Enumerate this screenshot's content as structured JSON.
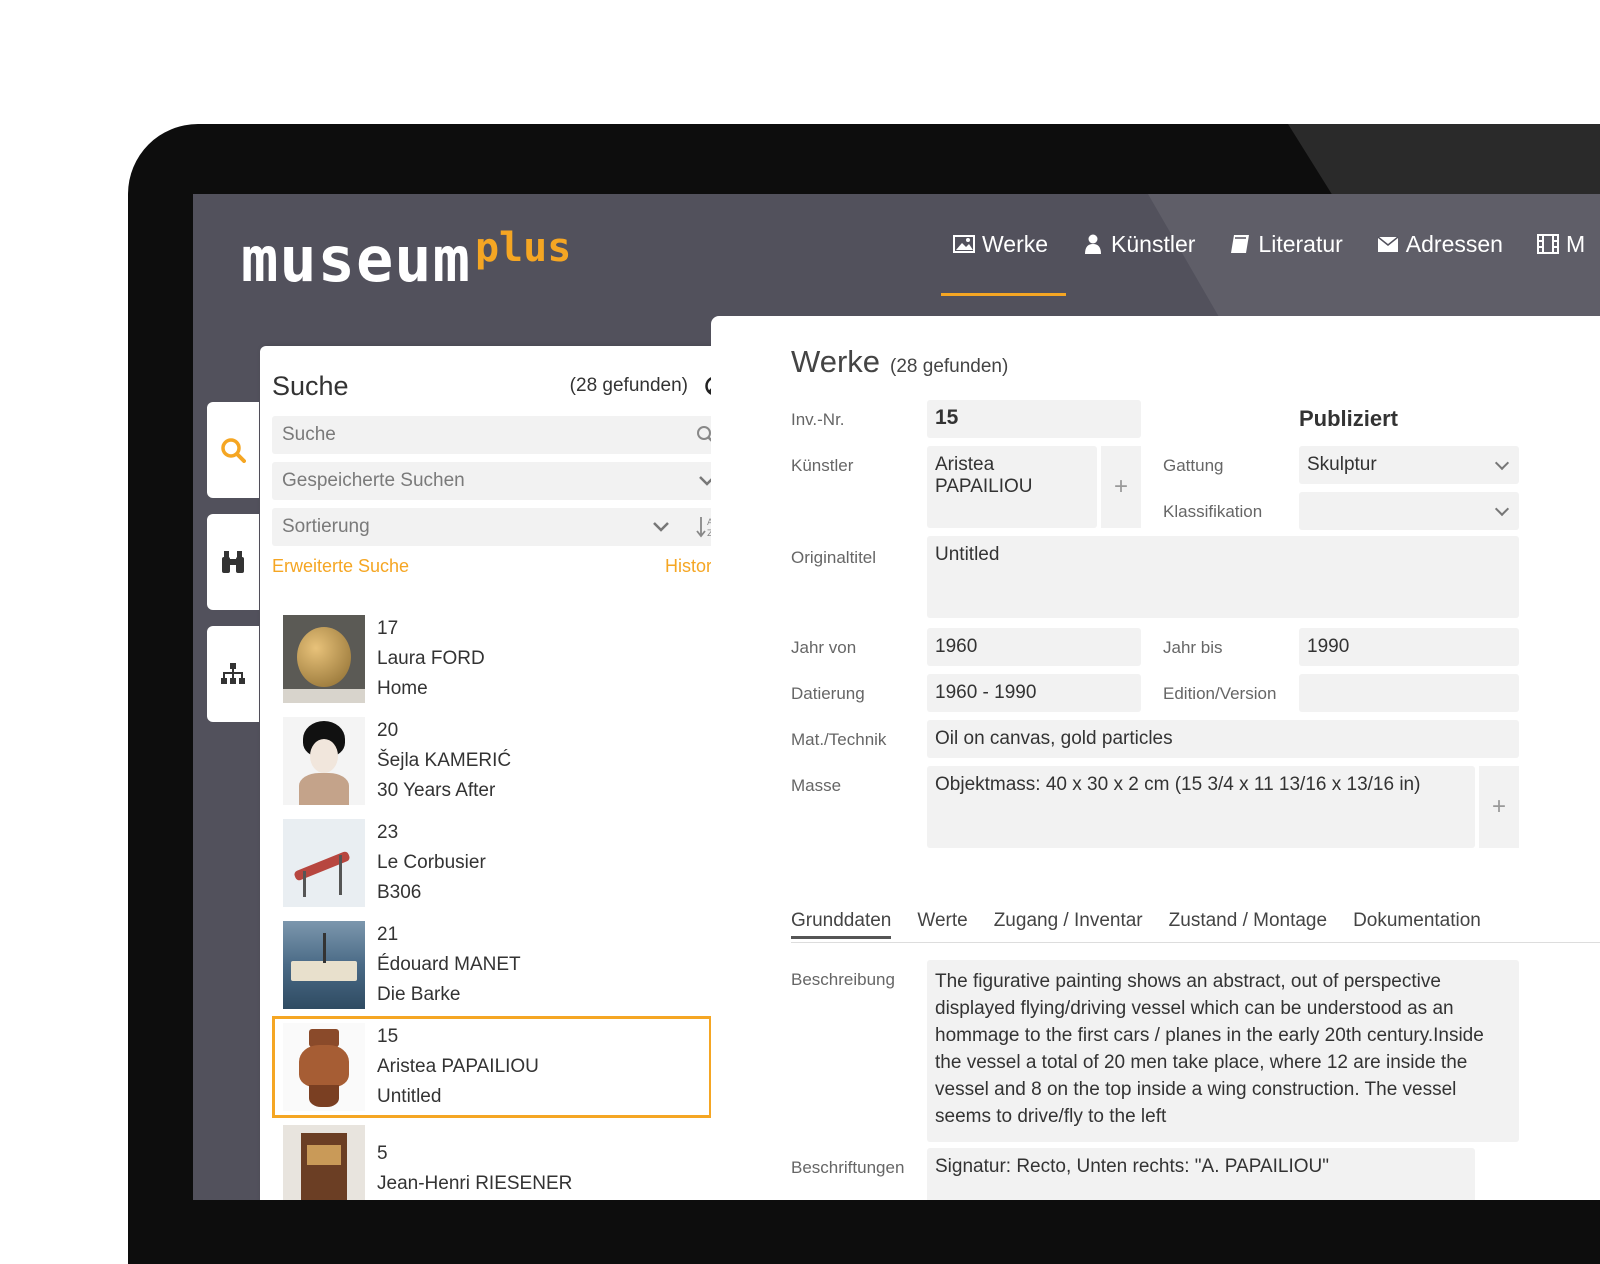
{
  "app": {
    "logo_main": "museum",
    "logo_plus": "plus"
  },
  "nav": [
    {
      "label": "Werke",
      "icon": "image-icon",
      "active": true
    },
    {
      "label": "Künstler",
      "icon": "person-icon"
    },
    {
      "label": "Literatur",
      "icon": "book-icon"
    },
    {
      "label": "Adressen",
      "icon": "envelope-icon"
    },
    {
      "label": "M",
      "icon": "film-icon"
    }
  ],
  "search": {
    "title": "Suche",
    "count": "(28 gefunden)",
    "search_placeholder": "Suche",
    "saved_searches": "Gespeicherte Suchen",
    "sort": "Sortierung",
    "advanced": "Erweiterte Suche",
    "history": "Historie",
    "results": [
      {
        "id": "17",
        "artist": "Laura FORD",
        "title": "Home"
      },
      {
        "id": "20",
        "artist": "Šejla KAMERIĆ",
        "title": "30 Years After"
      },
      {
        "id": "23",
        "artist": "Le Corbusier",
        "title": "B306"
      },
      {
        "id": "21",
        "artist": "Édouard MANET",
        "title": "Die Barke"
      },
      {
        "id": "15",
        "artist": "Aristea PAPAILIOU",
        "title": "Untitled",
        "selected": true
      },
      {
        "id": "5",
        "artist": "Jean-Henri RIESENER",
        "title": ""
      }
    ]
  },
  "detail": {
    "title": "Werke",
    "count": "(28 gefunden)",
    "inv_label": "Inv.-Nr.",
    "inv_value": "15",
    "published": "Publiziert",
    "artist_label": "Künstler",
    "artist_value": "Aristea PAPAILIOU",
    "genre_label": "Gattung",
    "genre_value": "Skulptur",
    "class_label": "Klassifikation",
    "class_value": "",
    "orig_title_label": "Originaltitel",
    "orig_title_value": "Untitled",
    "year_from_label": "Jahr von",
    "year_from_value": "1960",
    "year_to_label": "Jahr bis",
    "year_to_value": "1990",
    "dating_label": "Datierung",
    "dating_value": "1960 - 1990",
    "edition_label": "Edition/Version",
    "edition_value": "",
    "material_label": "Mat./Technik",
    "material_value": "Oil on canvas, gold particles",
    "measure_label": "Masse",
    "measure_value": "Objektmass: 40 x 30 x 2 cm (15 3/4 x 11 13/16 x 13/16 in)",
    "tabs": [
      "Grunddaten",
      "Werte",
      "Zugang / Inventar",
      "Zustand / Montage",
      "Dokumentation"
    ],
    "desc_label": "Beschreibung",
    "desc_value": "The figurative painting shows an abstract, out of perspective displayed flying/driving vessel which can be understood as an hommage to the first cars / planes in the early 20th century.Inside the vessel a total of 20 men take place, where 12 are inside the vessel and 8 on the top inside a wing construction. The vessel seems to drive/fly to the left",
    "inscr_label": "Beschriftungen",
    "inscr_value": "Signatur: Recto, Unten rechts: \"A. PAPAILIOU\""
  },
  "colors": {
    "accent": "#f5a623",
    "chrome": "#52515c"
  }
}
